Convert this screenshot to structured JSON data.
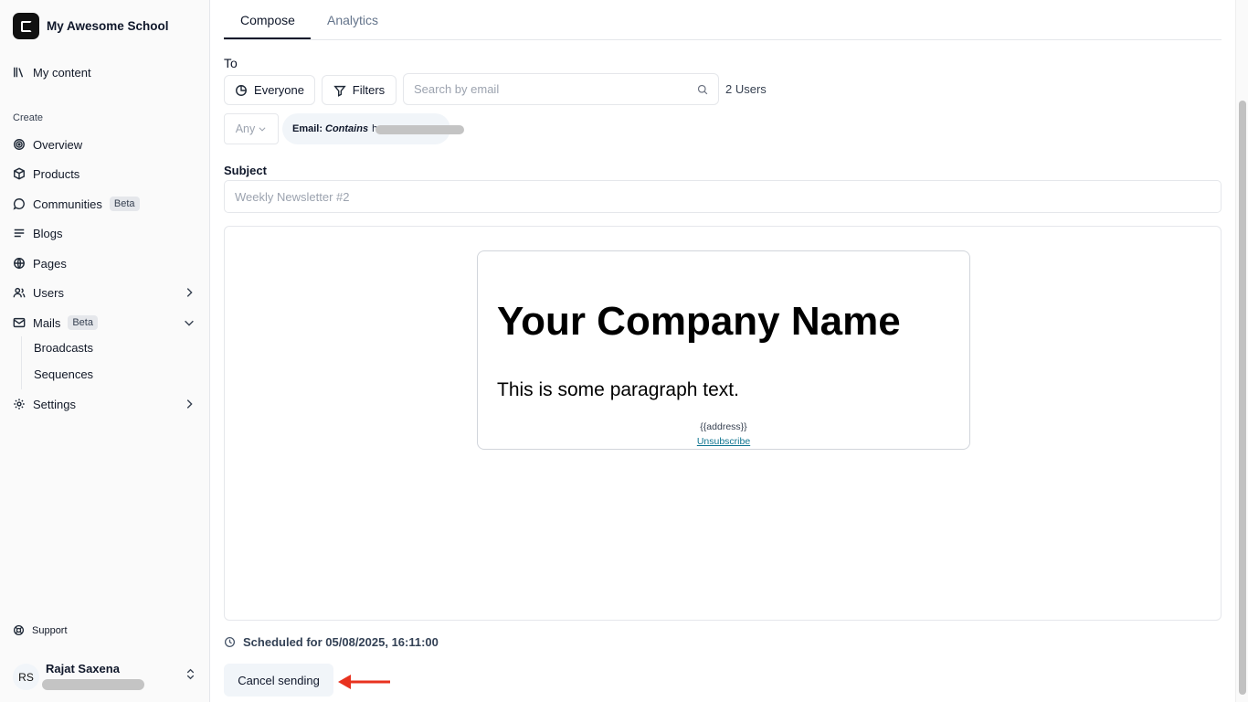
{
  "brand": {
    "name": "My Awesome School"
  },
  "sidebar": {
    "top_item": "My content",
    "section_label": "Create",
    "items": [
      {
        "label": "Overview",
        "icon": "target-icon"
      },
      {
        "label": "Products",
        "icon": "box-icon"
      },
      {
        "label": "Communities",
        "icon": "chat-icon",
        "badge": "Beta"
      },
      {
        "label": "Blogs",
        "icon": "lines-icon"
      },
      {
        "label": "Pages",
        "icon": "globe-icon"
      },
      {
        "label": "Users",
        "icon": "users-icon"
      },
      {
        "label": "Mails",
        "icon": "mail-icon",
        "badge": "Beta"
      },
      {
        "label": "Settings",
        "icon": "gear-icon"
      }
    ],
    "mails_sub": [
      "Broadcasts",
      "Sequences"
    ],
    "support": "Support",
    "user": {
      "initials": "RS",
      "name": "Rajat Saxena"
    }
  },
  "tabs": [
    "Compose",
    "Analytics"
  ],
  "compose": {
    "to_label": "To",
    "everyone_label": "Everyone",
    "filters_label": "Filters",
    "search_placeholder": "Search by email",
    "user_count": "2 Users",
    "any_label": "Any",
    "chip": {
      "field": "Email:",
      "op": "Contains",
      "value": "h"
    },
    "subject_label": "Subject",
    "subject_placeholder": "Weekly Newsletter #2"
  },
  "email_preview": {
    "title": "Your Company Name",
    "paragraph": "This is some paragraph text.",
    "address": "{{address}}",
    "unsubscribe": "Unsubscribe"
  },
  "footer": {
    "scheduled": "Scheduled for 05/08/2025, 16:11:00",
    "cancel_button": "Cancel sending"
  },
  "colors": {
    "arrow": "#e8321f"
  }
}
